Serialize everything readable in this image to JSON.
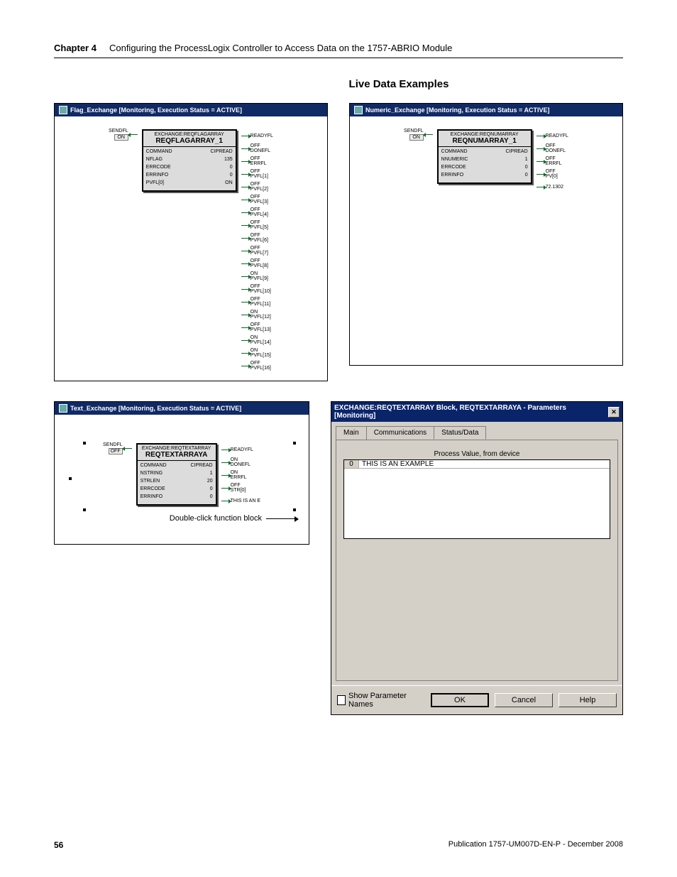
{
  "header": {
    "chapter_label": "Chapter 4",
    "chapter_title": "Configuring the ProcessLogix Controller to Access Data on the 1757-ABRIO Module"
  },
  "section_title": "Live Data Examples",
  "windows": {
    "flag": {
      "title": "Flag_Exchange [Monitoring, Execution Status = ACTIVE]",
      "block_type": "EXCHANGE:REQFLAGARRAY",
      "block_name": "REQFLAGARRAY_1",
      "rows": [
        {
          "k": "COMMAND",
          "v": "CIPREAD"
        },
        {
          "k": "NFLAG",
          "v": "135"
        },
        {
          "k": "ERRCODE",
          "v": "0"
        },
        {
          "k": "ERRINFO",
          "v": "0"
        },
        {
          "k": "PVFL[0]",
          "v": "ON"
        }
      ],
      "in_port": {
        "label": "SENDFL",
        "state": "ON"
      },
      "out_ports": [
        {
          "top": "READYFL",
          "bottom": ""
        },
        {
          "top": "OFF",
          "bottom": "DONEFL"
        },
        {
          "top": "OFF",
          "bottom": "ERRFL"
        },
        {
          "top": "OFF",
          "bottom": "PVFL[1]"
        },
        {
          "top": "OFF",
          "bottom": "PVFL[2]"
        },
        {
          "top": "OFF",
          "bottom": "PVFL[3]"
        },
        {
          "top": "OFF",
          "bottom": "PVFL[4]"
        },
        {
          "top": "OFF",
          "bottom": "PVFL[5]"
        },
        {
          "top": "OFF",
          "bottom": "PVFL[6]"
        },
        {
          "top": "OFF",
          "bottom": "PVFL[7]"
        },
        {
          "top": "OFF",
          "bottom": "PVFL[8]"
        },
        {
          "top": "ON",
          "bottom": "PVFL[9]"
        },
        {
          "top": "OFF",
          "bottom": "PVFL[10]"
        },
        {
          "top": "OFF",
          "bottom": "PVFL[11]"
        },
        {
          "top": "ON",
          "bottom": "PVFL[12]"
        },
        {
          "top": "OFF",
          "bottom": "PVFL[13]"
        },
        {
          "top": "ON",
          "bottom": "PVFL[14]"
        },
        {
          "top": "ON",
          "bottom": "PVFL[15]"
        },
        {
          "top": "OFF",
          "bottom": "PVFL[16]"
        }
      ]
    },
    "numeric": {
      "title": "Numeric_Exchange [Monitoring, Execution Status = ACTIVE]",
      "block_type": "EXCHANGE:REQNUMARRAY",
      "block_name": "REQNUMARRAY_1",
      "rows": [
        {
          "k": "COMMAND",
          "v": "CIPREAD"
        },
        {
          "k": "NNUMERIC",
          "v": "1"
        },
        {
          "k": "ERRCODE",
          "v": "0"
        },
        {
          "k": "ERRINFO",
          "v": "0"
        }
      ],
      "in_port": {
        "label": "SENDFL",
        "state": "ON"
      },
      "out_ports": [
        {
          "top": "READYFL",
          "bottom": ""
        },
        {
          "top": "OFF",
          "bottom": "DONEFL"
        },
        {
          "top": "OFF",
          "bottom": "ERRFL"
        },
        {
          "top": "OFF",
          "bottom": "PV[0]"
        },
        {
          "top": "72.1302",
          "bottom": ""
        }
      ]
    },
    "text": {
      "title": "Text_Exchange [Monitoring, Execution Status = ACTIVE]",
      "block_type": "EXCHANGE:REQTEXTARRAY",
      "block_name": "REQTEXTARRAYA",
      "rows": [
        {
          "k": "COMMAND",
          "v": "CIPREAD"
        },
        {
          "k": "NSTRING",
          "v": "1"
        },
        {
          "k": "STRLEN",
          "v": "20"
        },
        {
          "k": "ERRCODE",
          "v": "0"
        },
        {
          "k": "ERRINFO",
          "v": "0"
        }
      ],
      "in_port": {
        "label": "SENDFL",
        "state": "OFF"
      },
      "out_ports": [
        {
          "top": "READYFL",
          "bottom": ""
        },
        {
          "top": "ON",
          "bottom": "DONEFL"
        },
        {
          "top": "ON",
          "bottom": "ERRFL"
        },
        {
          "top": "OFF",
          "bottom": "STR[0]"
        },
        {
          "top": "THIS IS AN E",
          "bottom": ""
        }
      ],
      "hint": "Double-click function block"
    }
  },
  "dialog": {
    "title": "EXCHANGE:REQTEXTARRAY Block, REQTEXTARRAYA - Parameters [Monitoring]",
    "tabs": [
      "Main",
      "Communications",
      "Status/Data"
    ],
    "active_tab": 2,
    "pv_title": "Process Value, from device",
    "grid": [
      {
        "idx": "0",
        "val": "THIS IS AN EXAMPLE"
      }
    ],
    "show_param_label": "Show Parameter Names",
    "buttons": {
      "ok": "OK",
      "cancel": "Cancel",
      "help": "Help"
    }
  },
  "footer": {
    "page": "56",
    "pub": "Publication 1757-UM007D-EN-P - December 2008"
  }
}
